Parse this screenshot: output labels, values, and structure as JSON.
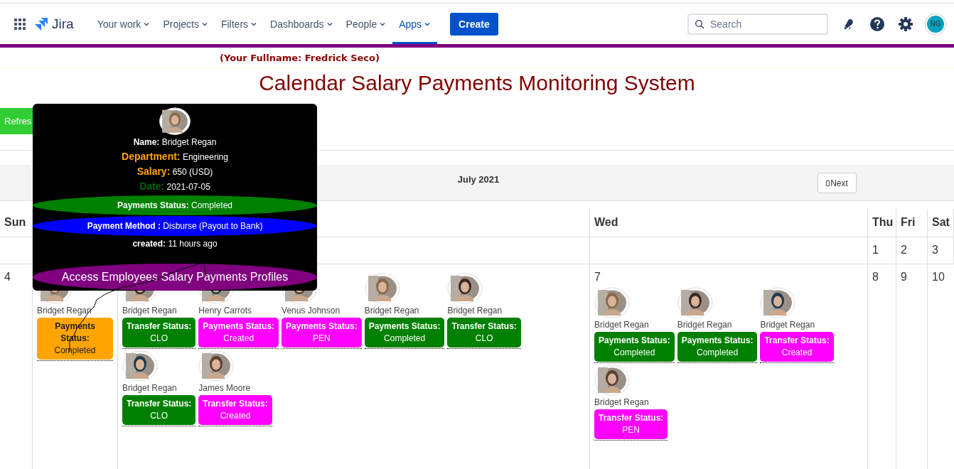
{
  "nav": {
    "logo": "Jira",
    "items": [
      {
        "label": "Your work",
        "selected": false
      },
      {
        "label": "Projects",
        "selected": false
      },
      {
        "label": "Filters",
        "selected": false
      },
      {
        "label": "Dashboards",
        "selected": false
      },
      {
        "label": "People",
        "selected": false
      },
      {
        "label": "Apps",
        "selected": true
      }
    ],
    "create": "Create",
    "search": {
      "placeholder": "Search"
    },
    "avatar": "NG"
  },
  "subtitle": "(Your Fullname: Fredrick Seco)",
  "title": "Calendar Salary Payments Monitoring System",
  "refresh_button": "Refres",
  "calendar": {
    "month": "July 2021",
    "next": "Next",
    "columns": [
      {
        "label": "Sun"
      },
      {},
      {},
      {
        "label": "Wed"
      },
      {
        "label": "Thu"
      },
      {
        "label": "Fri"
      },
      {
        "label": "Sat"
      }
    ],
    "weeks": [
      [
        {
          "date": "1"
        },
        {
          "date": "2"
        },
        {
          "date": "3"
        }
      ],
      [
        {
          "date": "4"
        },
        {
          "events": [
            {
              "name": "Bridget Regan",
              "label": "Payments Status:",
              "status": "Completed",
              "color": "#ffa500"
            }
          ]
        },
        {
          "events": [
            {
              "name": "Bridget Regan",
              "label": "Transfer Status:",
              "status": "CLO",
              "color": "#008000"
            },
            {
              "name": "Henry Carrots",
              "label": "Payments Status:",
              "status": "Created",
              "color": "#ff00ff"
            },
            {
              "name": "Venus Johnson",
              "label": "Payments Status:",
              "status": "PEN",
              "color": "#ff00ff"
            },
            {
              "name": "Bridget Regan",
              "label": "Payments Status:",
              "status": "Completed",
              "color": "#008000"
            },
            {
              "name": "Bridget Regan",
              "label": "Transfer Status:",
              "status": "CLO",
              "color": "#008000"
            },
            {
              "name": "Bridget Regan",
              "label": "Transfer Status:",
              "status": "CLO",
              "color": "#008000"
            },
            {
              "name": "James Moore",
              "label": "Transfer Status:",
              "status": "Created",
              "color": "#ff00ff"
            }
          ]
        },
        {
          "date": "7",
          "events": [
            {
              "name": "Bridget Regan",
              "label": "Payments Status:",
              "status": "Completed",
              "color": "#008000"
            },
            {
              "name": "Bridget Regan",
              "label": "Payments Status:",
              "status": "Completed",
              "color": "#008000"
            },
            {
              "name": "Bridget Regan",
              "label": "Transfer Status:",
              "status": "Created",
              "color": "#ff00ff"
            },
            {
              "name": "Bridget Regan",
              "label": "Transfer Status:",
              "status": "PEN",
              "color": "#ff00ff"
            }
          ]
        },
        {
          "date": "8"
        },
        {
          "date": "9"
        },
        {
          "date": "10"
        }
      ]
    ]
  },
  "popup": {
    "lines": [
      {
        "label": "Name:",
        "value": "Bridget Regan",
        "color": "#ffffff"
      },
      {
        "label": "Department:",
        "value": "Engineering",
        "color": "#ffa500"
      },
      {
        "label": "Salary:",
        "value": "650 (USD)",
        "color": "#ffa500"
      },
      {
        "label": "Date:",
        "value": "2021-07-05",
        "color": "#006400"
      }
    ],
    "bands": [
      {
        "label": "Payments Status:",
        "value": "Completed",
        "color": "#008000"
      },
      {
        "label": "Payment Method :",
        "value": "Disburse (Payout to Bank)",
        "color": "#0000ff"
      }
    ],
    "created": {
      "label": "created:",
      "value": "11 hours ago"
    },
    "profiles_button": "Access Employees Salary Payments Profiles"
  }
}
